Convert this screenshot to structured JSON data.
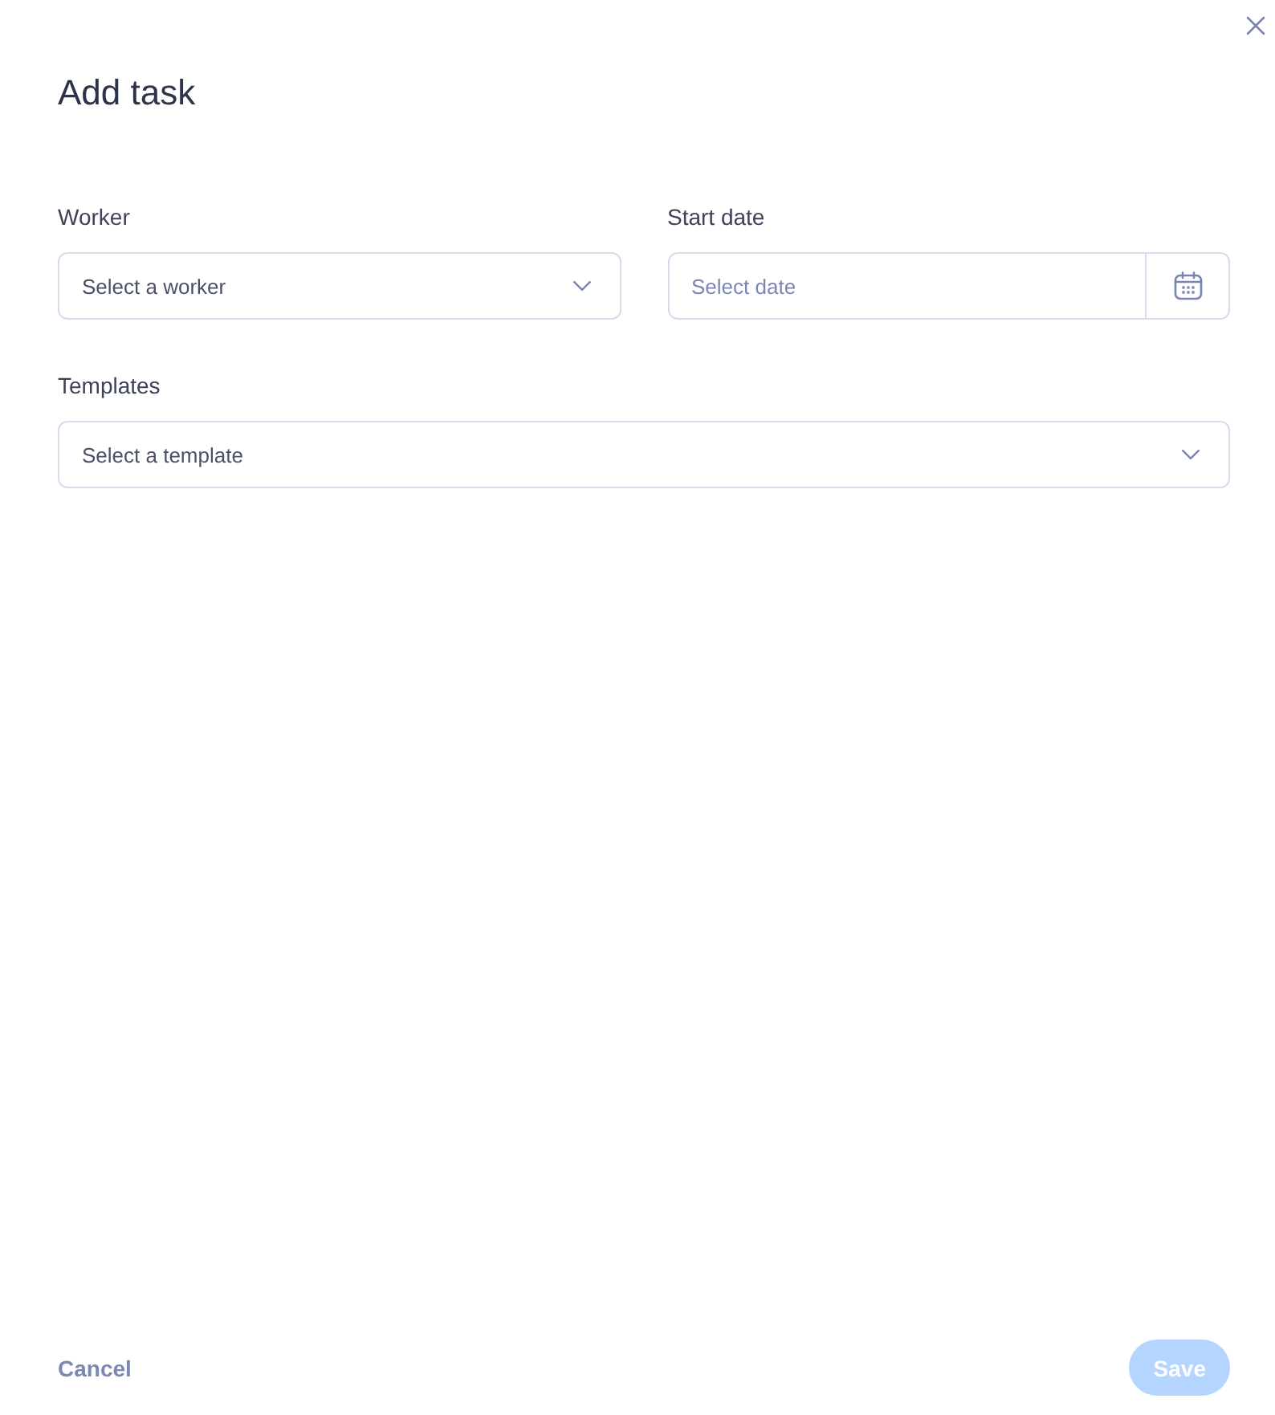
{
  "dialog": {
    "title": "Add task"
  },
  "rows": [
    {
      "fields": [
        {
          "kind": "select",
          "label": "Worker",
          "placeholder": "Select a worker"
        },
        {
          "kind": "date",
          "label": "Start date",
          "placeholder": "Select date"
        }
      ]
    },
    {
      "fields": [
        {
          "kind": "select",
          "label": "Templates",
          "placeholder": "Select a template"
        }
      ]
    }
  ],
  "footer": {
    "cancel": {
      "label": "Cancel"
    },
    "save": {
      "label": "Save",
      "disabled": true
    }
  }
}
